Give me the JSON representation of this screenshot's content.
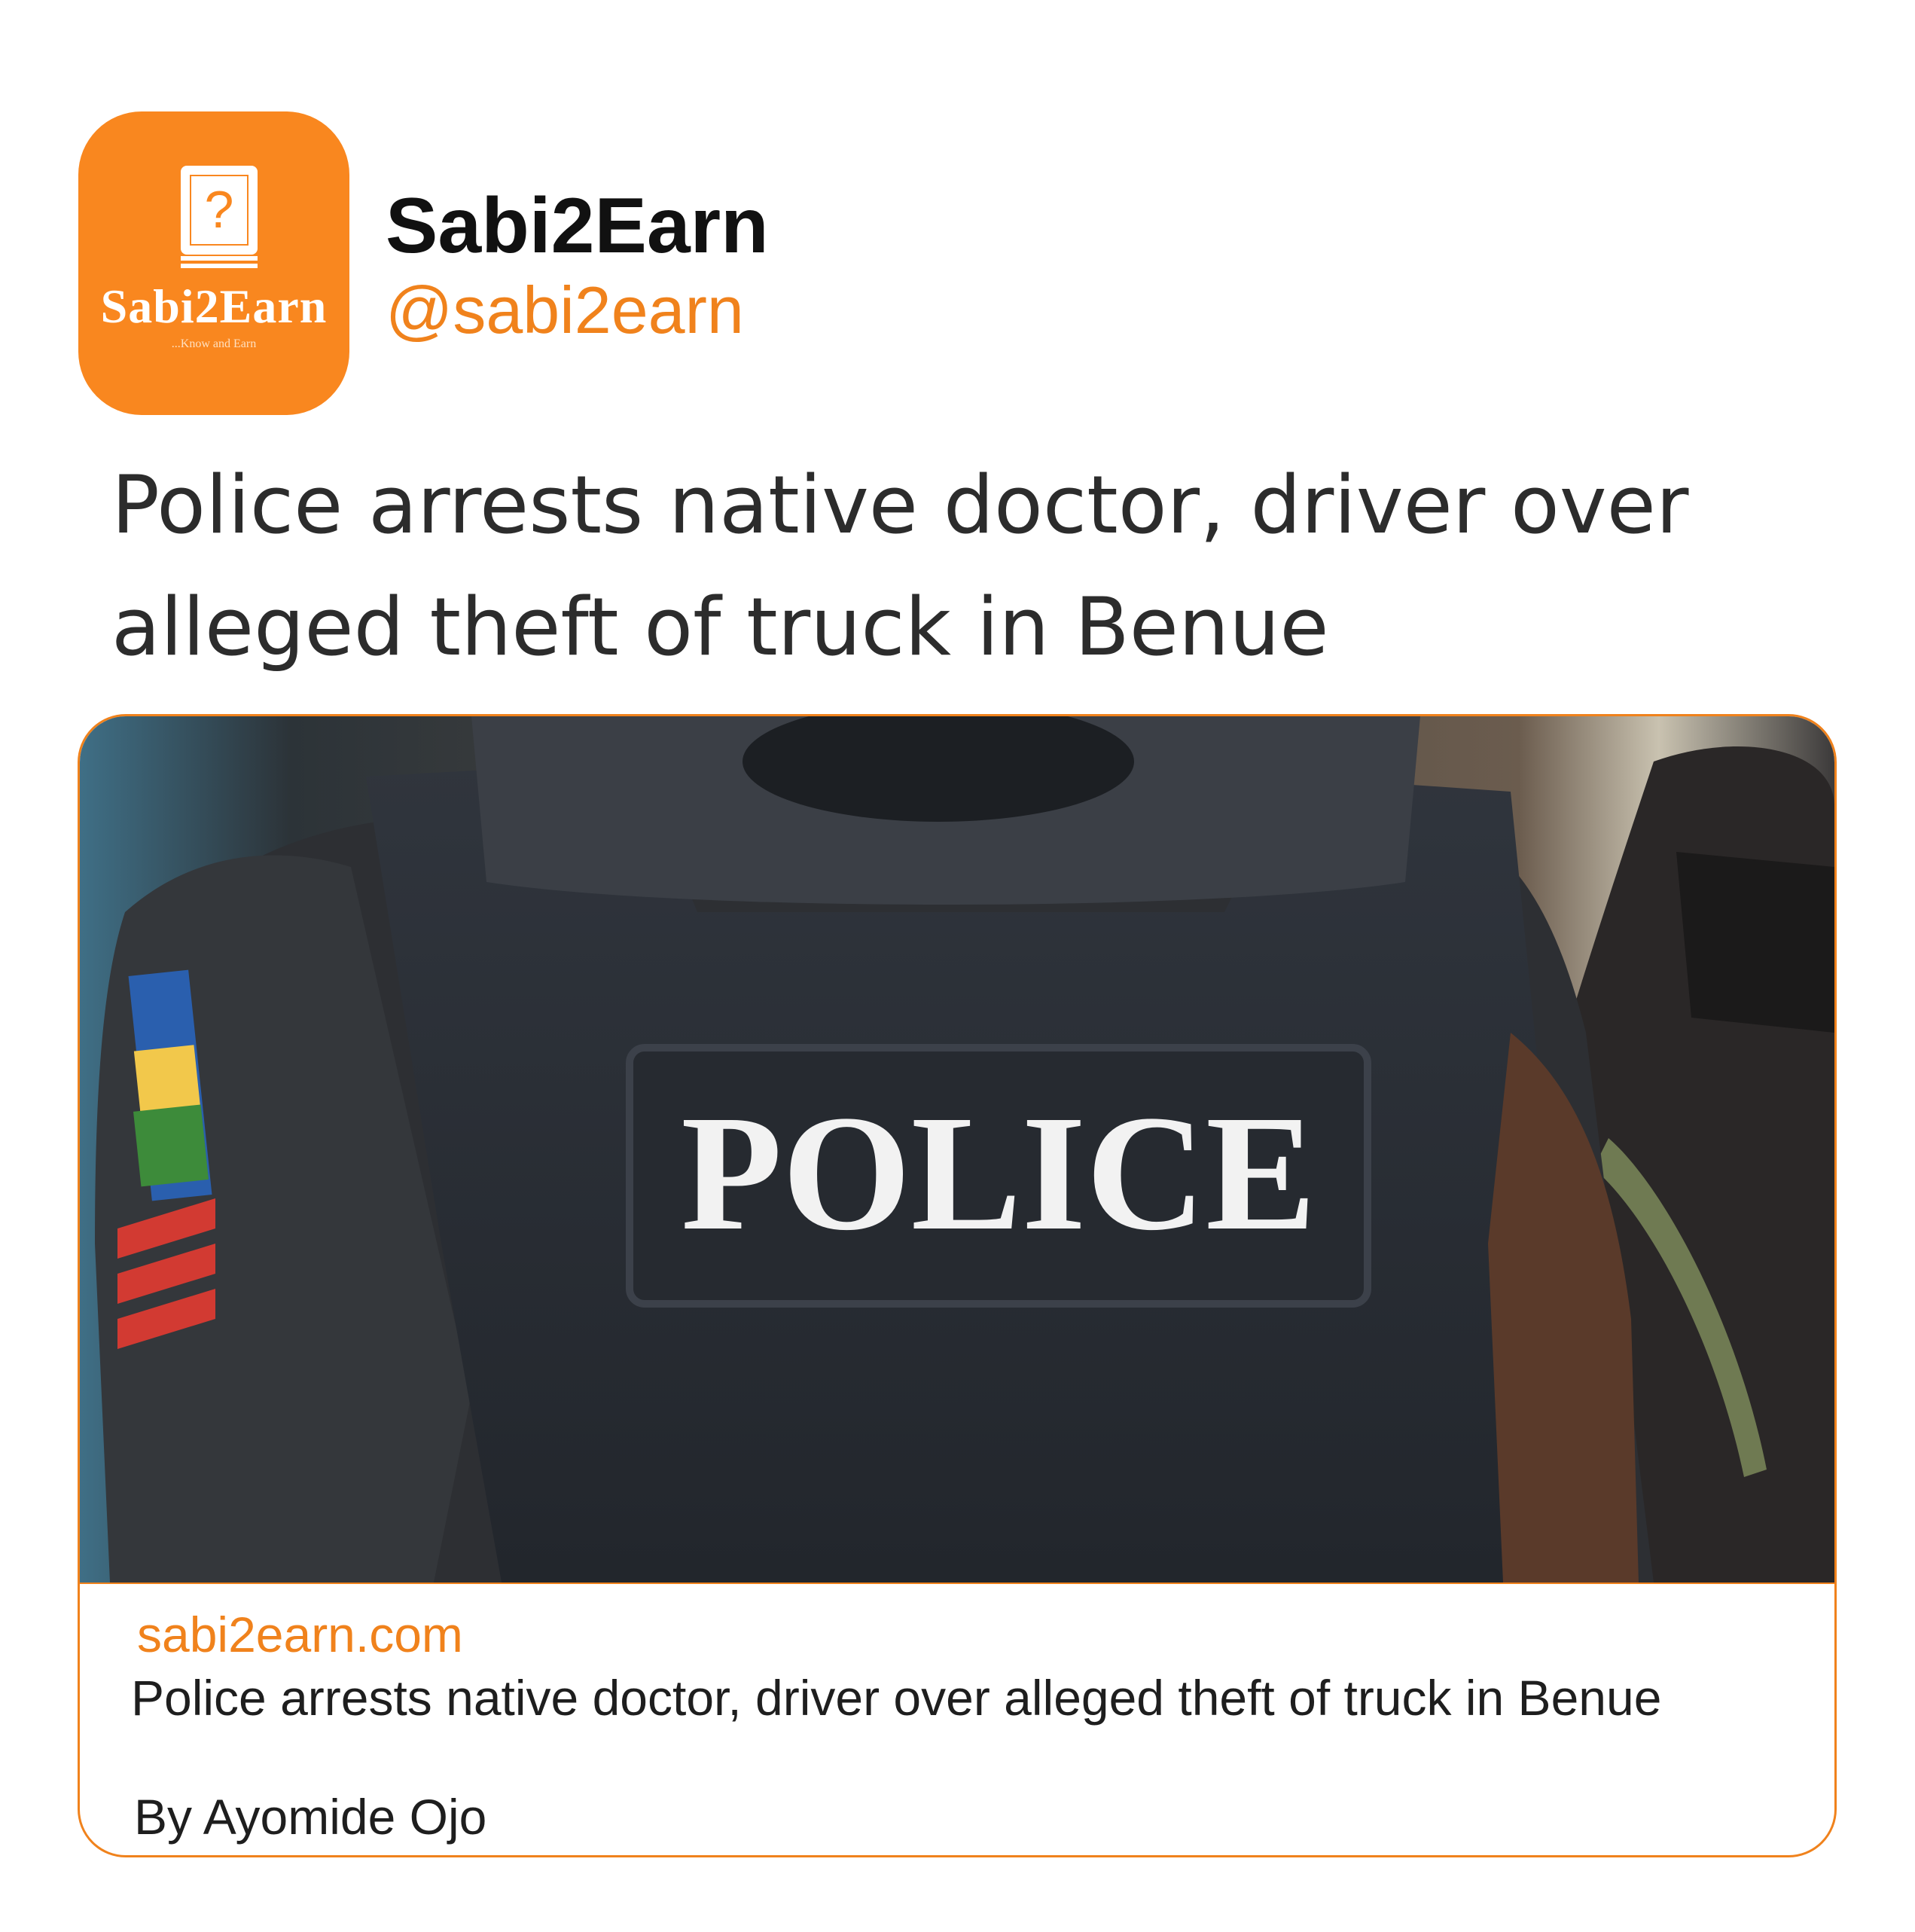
{
  "avatar": {
    "brand_text": "Sabi2Earn",
    "tagline": "...Know and Earn",
    "icon": "question-book-icon",
    "color": "#f9871f"
  },
  "profile": {
    "display_name": "Sabi2Earn",
    "handle": "@sabi2earn"
  },
  "post": {
    "headline": "Police arrests native doctor, driver over alleged theft of truck in Benue"
  },
  "card": {
    "image_caption_text": "POLICE",
    "domain": "sabi2earn.com",
    "title": "Police arrests native doctor, driver over alleged theft of truck in Benue",
    "author": "By Ayomide Ojo"
  },
  "colors": {
    "accent": "#f0821c",
    "text": "#1e1e1e"
  }
}
